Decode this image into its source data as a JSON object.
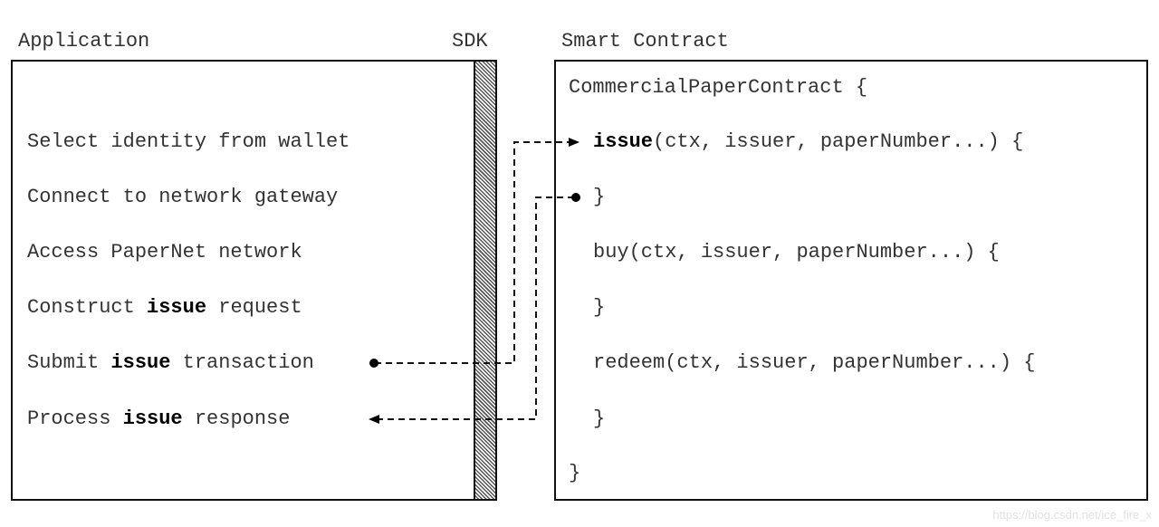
{
  "headers": {
    "application": "Application",
    "sdk": "SDK",
    "smart_contract": "Smart Contract"
  },
  "application": {
    "steps": [
      {
        "pre": "Select identity from wallet",
        "bold": "",
        "post": ""
      },
      {
        "pre": "Connect to network gateway",
        "bold": "",
        "post": ""
      },
      {
        "pre": "Access PaperNet network",
        "bold": "",
        "post": ""
      },
      {
        "pre": "Construct ",
        "bold": "issue",
        "post": " request"
      },
      {
        "pre": "Submit ",
        "bold": "issue",
        "post": " transaction"
      },
      {
        "pre": "Process ",
        "bold": "issue",
        "post": " response"
      }
    ]
  },
  "contract": {
    "class_open": "CommercialPaperContract {",
    "methods": [
      {
        "name": "issue",
        "bold": true,
        "args": "(ctx, issuer, paperNumber...) {",
        "close": "}"
      },
      {
        "name": "buy",
        "bold": false,
        "args": "(ctx, issuer, paperNumber...) {",
        "close": "}"
      },
      {
        "name": "redeem",
        "bold": false,
        "args": "(ctx, issuer, paperNumber...) {",
        "close": "}"
      }
    ],
    "class_close": "}"
  },
  "connectors": [
    {
      "from": "submit-issue-transaction",
      "to": "issue-method",
      "kind": "request"
    },
    {
      "from": "issue-method-close",
      "to": "process-issue-response",
      "kind": "response"
    }
  ],
  "watermark": "https://blog.csdn.net/ice_fire_x"
}
